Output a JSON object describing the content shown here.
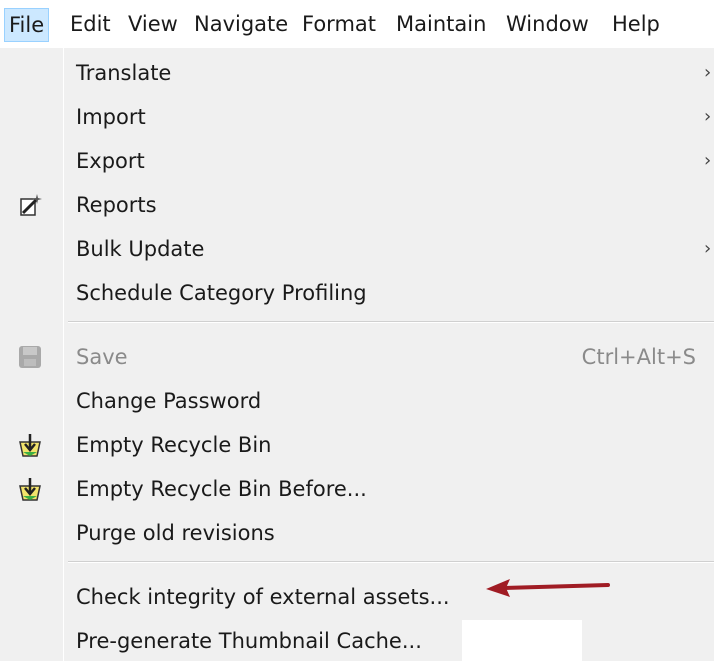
{
  "menubar": {
    "file": "File",
    "edit": "Edit",
    "view": "View",
    "navigate": "Navigate",
    "format": "Format",
    "maintain": "Maintain",
    "window": "Window",
    "help": "Help"
  },
  "menu": {
    "items": [
      {
        "label": "Translate",
        "has_submenu": true
      },
      {
        "label": "Import",
        "has_submenu": true
      },
      {
        "label": "Export",
        "has_submenu": true
      },
      {
        "label": "Reports",
        "icon": "wand-icon"
      },
      {
        "label": "Bulk Update",
        "has_submenu": true
      },
      {
        "label": "Schedule Category Profiling"
      },
      {
        "label": "Save",
        "shortcut": "Ctrl+Alt+S",
        "icon": "save-icon",
        "disabled": true
      },
      {
        "label": "Change Password"
      },
      {
        "label": "Empty Recycle Bin",
        "icon": "recycle-bin-icon"
      },
      {
        "label": "Empty Recycle Bin Before...",
        "icon": "recycle-bin-icon"
      },
      {
        "label": "Purge old revisions"
      },
      {
        "label": "Check integrity of external assets..."
      },
      {
        "label": "Pre-generate Thumbnail Cache..."
      }
    ],
    "submenu_glyph": "›"
  },
  "colors": {
    "menu_bg": "#f0f0f0",
    "active_bg": "#cce8ff",
    "annotation_arrow": "#a01c24"
  }
}
